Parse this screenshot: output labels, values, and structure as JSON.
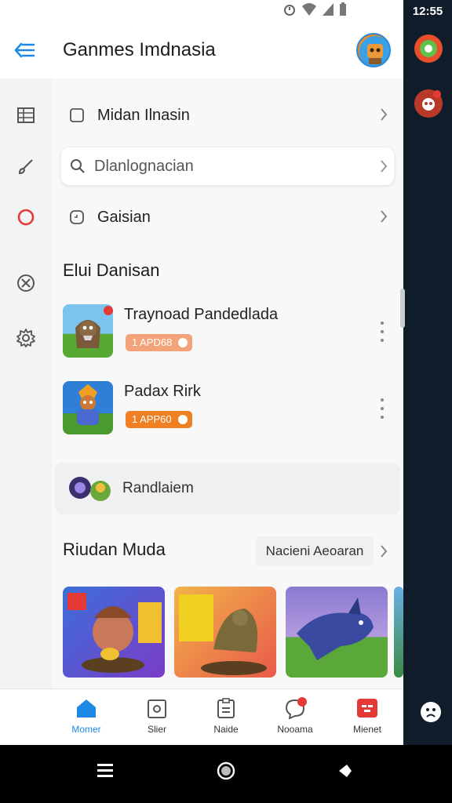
{
  "status": {
    "time": "12:55"
  },
  "app_bar": {
    "title": "Ganmes Imdnasia"
  },
  "list_rows": [
    {
      "label": "Midan Ilnasin"
    },
    {
      "label": "Dlanlognacian"
    },
    {
      "label": "Gaisian"
    }
  ],
  "section1": {
    "title": "Elui Danisan"
  },
  "games": [
    {
      "name": "Traynoad Pandedlada",
      "badge": "1 APD68",
      "badge_color": "#f3a37a"
    },
    {
      "name": "Padax Rirk",
      "badge": "1 APP60",
      "badge_color": "#ee7f22"
    }
  ],
  "banner": {
    "label": "Randlaiem"
  },
  "section2": {
    "title": "Riudan Muda",
    "see_all": "Nacieni Aeoaran"
  },
  "bottom_nav": [
    {
      "label": "Momer"
    },
    {
      "label": "Slier"
    },
    {
      "label": "Naide"
    },
    {
      "label": "Nooama"
    },
    {
      "label": "Mienet"
    }
  ],
  "colors": {
    "accent": "#1e88e5",
    "rail_dark": "#111c2b",
    "red": "#e53935",
    "orange": "#ee7f22"
  }
}
